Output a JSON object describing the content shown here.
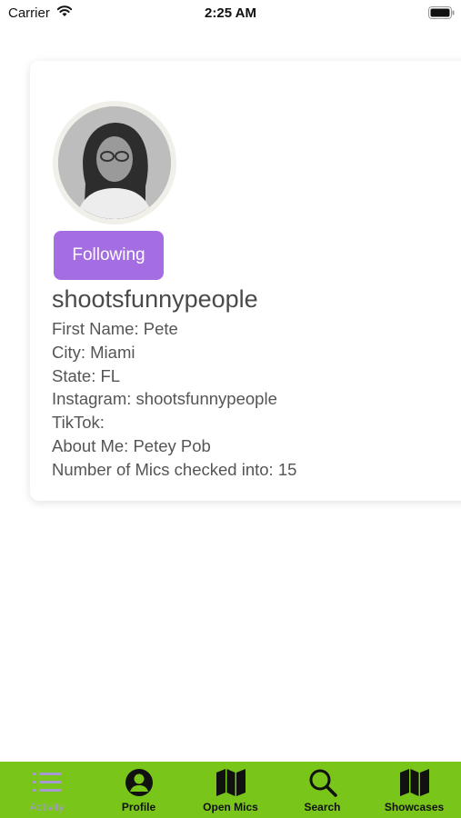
{
  "status_bar": {
    "carrier": "Carrier",
    "time": "2:25 AM"
  },
  "profile": {
    "follow_button_label": "Following",
    "username": "shootsfunnypeople",
    "details": [
      "First Name: Pete",
      "City: Miami",
      "State: FL",
      "Instagram: shootsfunnypeople",
      "TikTok:",
      "About Me: Petey Pob",
      "Number of Mics checked into: 15"
    ]
  },
  "tab_bar": {
    "background_color": "#79c51a",
    "active_tab": "Activity",
    "tabs": [
      {
        "label": "Activity",
        "icon": "list-icon"
      },
      {
        "label": "Profile",
        "icon": "person-circle-icon"
      },
      {
        "label": "Open Mics",
        "icon": "map-icon"
      },
      {
        "label": "Search",
        "icon": "magnifier-icon"
      },
      {
        "label": "Showcases",
        "icon": "map-icon"
      }
    ]
  },
  "colors": {
    "accent": "#a56de2",
    "tab_active": "#a59ad0"
  }
}
